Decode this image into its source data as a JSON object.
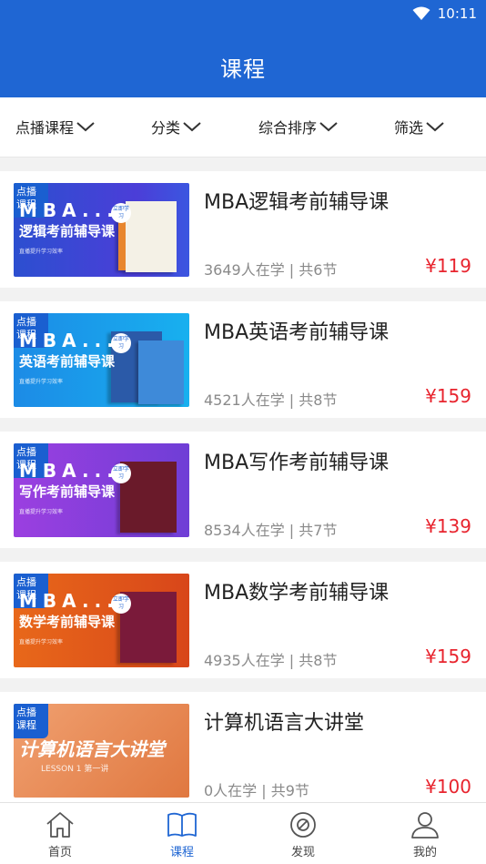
{
  "status_bar": {
    "time": "10:11"
  },
  "header": {
    "title": "课程"
  },
  "filters": [
    {
      "label": "点播课程"
    },
    {
      "label": "分类"
    },
    {
      "label": "综合排序"
    },
    {
      "label": "筛选"
    }
  ],
  "courses": [
    {
      "name": "MBA逻辑考前辅导课",
      "meta": "3649人在学 | 共6节",
      "price": "¥119",
      "thumb": {
        "tag_line1": "点播",
        "tag_line2": "课程",
        "mba": "MBA...",
        "subtitle": "逻辑考前辅导课",
        "slogan": "直播提升学习效率",
        "stamp": "立即学习"
      }
    },
    {
      "name": "MBA英语考前辅导课",
      "meta": "4521人在学 | 共8节",
      "price": "¥159",
      "thumb": {
        "tag_line1": "点播",
        "tag_line2": "课程",
        "mba": "MBA...",
        "subtitle": "英语考前辅导课",
        "slogan": "直播提升学习效率",
        "stamp": "立即学习"
      }
    },
    {
      "name": "MBA写作考前辅导课",
      "meta": "8534人在学 | 共7节",
      "price": "¥139",
      "thumb": {
        "tag_line1": "点播",
        "tag_line2": "课程",
        "mba": "MBA...",
        "subtitle": "写作考前辅导课",
        "slogan": "直播提升学习效率",
        "stamp": "立即学习"
      }
    },
    {
      "name": "MBA数学考前辅导课",
      "meta": "4935人在学 | 共8节",
      "price": "¥159",
      "thumb": {
        "tag_line1": "点播",
        "tag_line2": "课程",
        "mba": "MBA...",
        "subtitle": "数学考前辅导课",
        "slogan": "直播提升学习效率",
        "stamp": "立即学习"
      }
    },
    {
      "name": "计算机语言大讲堂",
      "meta": "0人在学 | 共9节",
      "price": "¥100",
      "thumb": {
        "tag_line1": "点播",
        "tag_line2": "课程",
        "mba": "",
        "subtitle": "计算机语言大讲堂",
        "slogan": "LESSON 1 第一讲",
        "stamp": ""
      }
    }
  ],
  "tabbar": [
    {
      "label": "首页",
      "icon": "home-icon",
      "active": false
    },
    {
      "label": "课程",
      "icon": "book-icon",
      "active": true
    },
    {
      "label": "发现",
      "icon": "compass-icon",
      "active": false
    },
    {
      "label": "我的",
      "icon": "user-icon",
      "active": false
    }
  ],
  "colors": {
    "primary": "#1f66d3",
    "price": "#e8242e",
    "thumb_blue": "#2f55d4",
    "thumb_cyan": "#1a9ee8",
    "thumb_purple": "#8a3fd8",
    "thumb_orange": "#e25a1c",
    "thumb_peach": "#e8874f"
  }
}
